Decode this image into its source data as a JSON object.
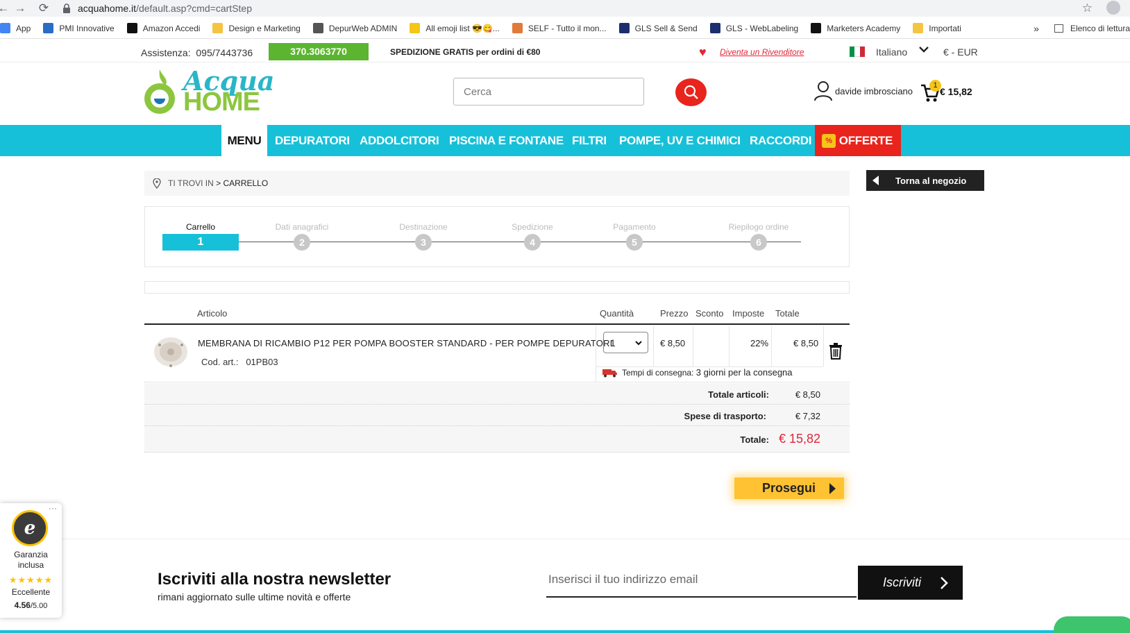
{
  "browser": {
    "url_host": "acquahome.it",
    "url_path": "/default.asp?cmd=cartStep",
    "bookmarks": [
      {
        "label": "App",
        "color": "#4285f4"
      },
      {
        "label": "PMI Innovative",
        "color": "#2b6cc4"
      },
      {
        "label": "Amazon Accedi",
        "color": "#111111"
      },
      {
        "label": "Design e Marketing",
        "color": "#f4c542"
      },
      {
        "label": "DepurWeb ADMIN",
        "color": "#555555"
      },
      {
        "label": "All emoji list 😎😋...",
        "color": "#f5c518"
      },
      {
        "label": "SELF - Tutto il mon...",
        "color": "#e07b39"
      },
      {
        "label": "GLS Sell & Send",
        "color": "#1b2f6e"
      },
      {
        "label": "GLS - WebLabeling",
        "color": "#1b2f6e"
      },
      {
        "label": "Marketers Academy",
        "color": "#111111"
      },
      {
        "label": "Importati",
        "color": "#f4c542"
      }
    ],
    "more": "»",
    "reading_list": "Elenco di lettura"
  },
  "topbar": {
    "assistance_label": "Assistenza:",
    "phone1": "095/7443736",
    "phone2": "370.3063770",
    "shipping": "SPEDIZIONE GRATIS per ordini di €80",
    "dealer_link": "Diventa un Rivenditore",
    "language": "Italiano",
    "currency": "€ - EUR"
  },
  "header": {
    "logo_line1": "Acqua",
    "logo_line2": "HOME",
    "search_placeholder": "Cerca",
    "user_name": "davide imbrosciano",
    "cart_count": "1",
    "cart_total": "€ 15,82"
  },
  "nav": {
    "items": [
      "MENU",
      "DEPURATORI",
      "ADDOLCITORI",
      "PISCINA E FONTANE",
      "FILTRI",
      "POMPE, UV E CHIMICI",
      "RACCORDI",
      "OFFERTE"
    ]
  },
  "breadcrumb": {
    "prefix": "TI TROVI IN",
    "separator": ">",
    "current": "CARRELLO"
  },
  "back_button": "Torna al negozio",
  "steps": [
    {
      "label": "Carrello",
      "number": "1",
      "active": true
    },
    {
      "label": "Dati anagrafici",
      "number": "2",
      "active": false
    },
    {
      "label": "Destinazione",
      "number": "3",
      "active": false
    },
    {
      "label": "Spedizione",
      "number": "4",
      "active": false
    },
    {
      "label": "Pagamento",
      "number": "5",
      "active": false
    },
    {
      "label": "Riepilogo ordine",
      "number": "6",
      "active": false
    }
  ],
  "table": {
    "headers": {
      "article": "Articolo",
      "quantity": "Quantità",
      "price": "Prezzo",
      "discount": "Sconto",
      "tax": "Imposte",
      "total": "Totale"
    },
    "item": {
      "name": "MEMBRANA DI RICAMBIO P12 PER POMPA BOOSTER STANDARD - PER POMPE DEPURATORI",
      "code_label": "Cod. art.:",
      "code": "01PB03",
      "quantity": "1",
      "price": "€ 8,50",
      "discount": "",
      "tax": "22%",
      "total": "€ 8,50",
      "delivery_label": "Tempi di consegna:",
      "delivery_value": "3 giorni per la consegna"
    }
  },
  "summary": {
    "items_label": "Totale articoli:",
    "items_value": "€ 8,50",
    "shipping_label": "Spese di trasporto:",
    "shipping_value": "€ 7,32",
    "total_label": "Totale:",
    "total_value": "€ 15,82"
  },
  "proceed_button": "Prosegui",
  "newsletter": {
    "title": "Iscriviti alla nostra newsletter",
    "subtitle": "rimani aggiornato sulle ultime novità e offerte",
    "email_placeholder": "Inserisci il tuo indirizzo email",
    "button": "Iscriviti"
  },
  "trusted_shops": {
    "label1": "Garanzia",
    "label2": "inclusa",
    "stars": "★★★★★",
    "rating_label": "Eccellente",
    "score": "4.56",
    "score_max": "/5.00"
  },
  "colors": {
    "brand_teal": "#16c0d8",
    "brand_red": "#e8241c",
    "brand_green": "#5cb531",
    "cta_yellow": "#ffc233"
  }
}
